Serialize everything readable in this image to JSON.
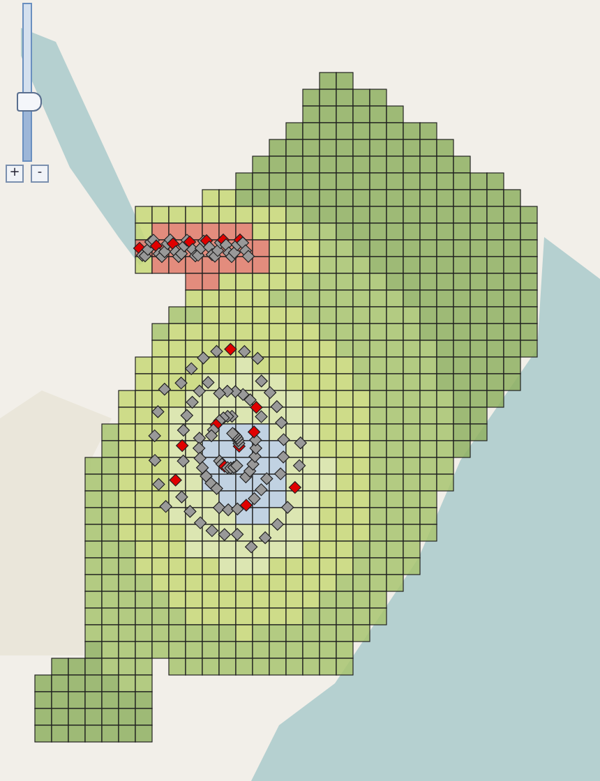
{
  "zoom_control": {
    "level": 0.38,
    "buttons": [
      "+",
      "-"
    ]
  }
}
